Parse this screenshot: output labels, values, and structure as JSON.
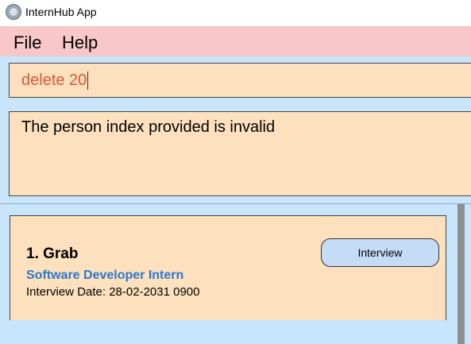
{
  "window": {
    "title": "InternHub App",
    "icon": "app-logo-icon"
  },
  "menu": {
    "items": [
      "File",
      "Help"
    ]
  },
  "command_box": {
    "value": "delete 20"
  },
  "result_box": {
    "message": "The person index provided is invalid"
  },
  "list": {
    "items": [
      {
        "index_name": "1.  Grab",
        "role": "Software Developer Intern",
        "interview_date": "Interview Date: 28-02-2031 0900",
        "status": "Interview"
      }
    ]
  },
  "colors": {
    "menubar": "#f8c7c7",
    "background": "#c8e5fb",
    "panel": "#fde0bd",
    "command_text": "#d45a3a",
    "role_text": "#2979cc",
    "badge": "#c5dbf6"
  }
}
